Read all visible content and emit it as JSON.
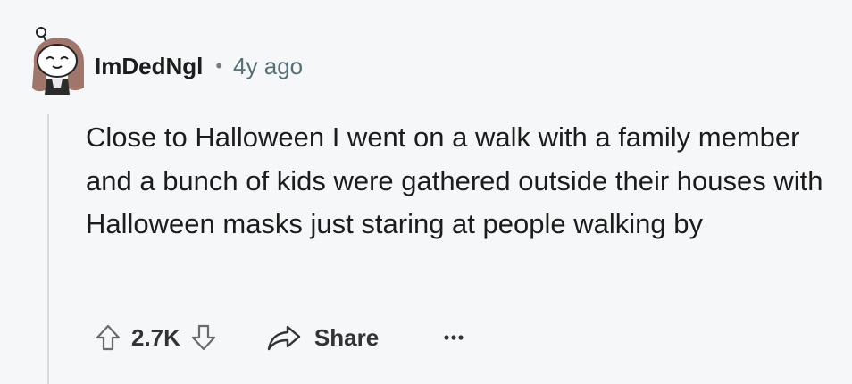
{
  "comment": {
    "author": "ImDedNgl",
    "separator": "•",
    "timestamp": "4y ago",
    "body": "Close to Halloween I went on a walk with a family member and a bunch of kids were gathered outside their houses with Halloween masks just staring at people walking by",
    "score": "2.7K",
    "share_label": "Share",
    "more_label": "···"
  },
  "icons": {
    "avatar": "avatar-icon",
    "upvote": "upvote-arrow-icon",
    "downvote": "downvote-arrow-icon",
    "share": "share-arrow-icon",
    "more": "more-options-icon"
  },
  "colors": {
    "background": "#f6f7f8",
    "text": "#1c1c1c",
    "meta": "#576f76",
    "thread_line": "#dadcde"
  }
}
